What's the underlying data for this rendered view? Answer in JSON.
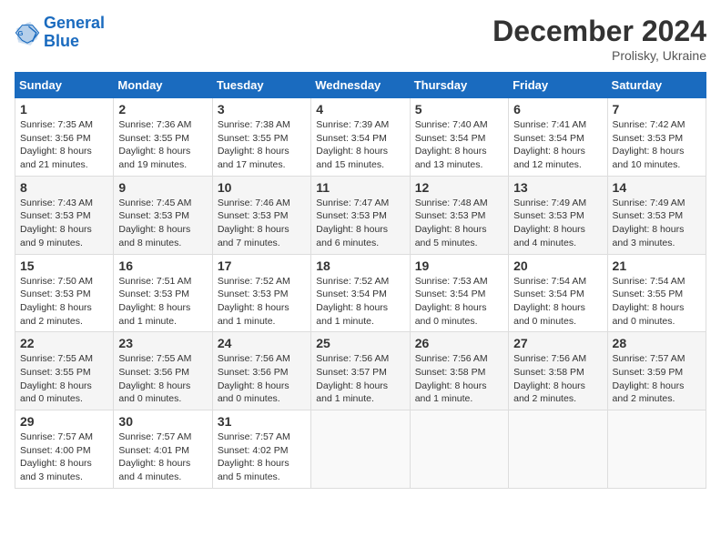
{
  "header": {
    "logo_line1": "General",
    "logo_line2": "Blue",
    "month": "December 2024",
    "location": "Prolisky, Ukraine"
  },
  "days_of_week": [
    "Sunday",
    "Monday",
    "Tuesday",
    "Wednesday",
    "Thursday",
    "Friday",
    "Saturday"
  ],
  "weeks": [
    [
      {
        "day": "1",
        "sunrise": "7:35 AM",
        "sunset": "3:56 PM",
        "daylight": "8 hours and 21 minutes."
      },
      {
        "day": "2",
        "sunrise": "7:36 AM",
        "sunset": "3:55 PM",
        "daylight": "8 hours and 19 minutes."
      },
      {
        "day": "3",
        "sunrise": "7:38 AM",
        "sunset": "3:55 PM",
        "daylight": "8 hours and 17 minutes."
      },
      {
        "day": "4",
        "sunrise": "7:39 AM",
        "sunset": "3:54 PM",
        "daylight": "8 hours and 15 minutes."
      },
      {
        "day": "5",
        "sunrise": "7:40 AM",
        "sunset": "3:54 PM",
        "daylight": "8 hours and 13 minutes."
      },
      {
        "day": "6",
        "sunrise": "7:41 AM",
        "sunset": "3:54 PM",
        "daylight": "8 hours and 12 minutes."
      },
      {
        "day": "7",
        "sunrise": "7:42 AM",
        "sunset": "3:53 PM",
        "daylight": "8 hours and 10 minutes."
      }
    ],
    [
      {
        "day": "8",
        "sunrise": "7:43 AM",
        "sunset": "3:53 PM",
        "daylight": "8 hours and 9 minutes."
      },
      {
        "day": "9",
        "sunrise": "7:45 AM",
        "sunset": "3:53 PM",
        "daylight": "8 hours and 8 minutes."
      },
      {
        "day": "10",
        "sunrise": "7:46 AM",
        "sunset": "3:53 PM",
        "daylight": "8 hours and 7 minutes."
      },
      {
        "day": "11",
        "sunrise": "7:47 AM",
        "sunset": "3:53 PM",
        "daylight": "8 hours and 6 minutes."
      },
      {
        "day": "12",
        "sunrise": "7:48 AM",
        "sunset": "3:53 PM",
        "daylight": "8 hours and 5 minutes."
      },
      {
        "day": "13",
        "sunrise": "7:49 AM",
        "sunset": "3:53 PM",
        "daylight": "8 hours and 4 minutes."
      },
      {
        "day": "14",
        "sunrise": "7:49 AM",
        "sunset": "3:53 PM",
        "daylight": "8 hours and 3 minutes."
      }
    ],
    [
      {
        "day": "15",
        "sunrise": "7:50 AM",
        "sunset": "3:53 PM",
        "daylight": "8 hours and 2 minutes."
      },
      {
        "day": "16",
        "sunrise": "7:51 AM",
        "sunset": "3:53 PM",
        "daylight": "8 hours and 1 minute."
      },
      {
        "day": "17",
        "sunrise": "7:52 AM",
        "sunset": "3:53 PM",
        "daylight": "8 hours and 1 minute."
      },
      {
        "day": "18",
        "sunrise": "7:52 AM",
        "sunset": "3:54 PM",
        "daylight": "8 hours and 1 minute."
      },
      {
        "day": "19",
        "sunrise": "7:53 AM",
        "sunset": "3:54 PM",
        "daylight": "8 hours and 0 minutes."
      },
      {
        "day": "20",
        "sunrise": "7:54 AM",
        "sunset": "3:54 PM",
        "daylight": "8 hours and 0 minutes."
      },
      {
        "day": "21",
        "sunrise": "7:54 AM",
        "sunset": "3:55 PM",
        "daylight": "8 hours and 0 minutes."
      }
    ],
    [
      {
        "day": "22",
        "sunrise": "7:55 AM",
        "sunset": "3:55 PM",
        "daylight": "8 hours and 0 minutes."
      },
      {
        "day": "23",
        "sunrise": "7:55 AM",
        "sunset": "3:56 PM",
        "daylight": "8 hours and 0 minutes."
      },
      {
        "day": "24",
        "sunrise": "7:56 AM",
        "sunset": "3:56 PM",
        "daylight": "8 hours and 0 minutes."
      },
      {
        "day": "25",
        "sunrise": "7:56 AM",
        "sunset": "3:57 PM",
        "daylight": "8 hours and 1 minute."
      },
      {
        "day": "26",
        "sunrise": "7:56 AM",
        "sunset": "3:58 PM",
        "daylight": "8 hours and 1 minute."
      },
      {
        "day": "27",
        "sunrise": "7:56 AM",
        "sunset": "3:58 PM",
        "daylight": "8 hours and 2 minutes."
      },
      {
        "day": "28",
        "sunrise": "7:57 AM",
        "sunset": "3:59 PM",
        "daylight": "8 hours and 2 minutes."
      }
    ],
    [
      {
        "day": "29",
        "sunrise": "7:57 AM",
        "sunset": "4:00 PM",
        "daylight": "8 hours and 3 minutes."
      },
      {
        "day": "30",
        "sunrise": "7:57 AM",
        "sunset": "4:01 PM",
        "daylight": "8 hours and 4 minutes."
      },
      {
        "day": "31",
        "sunrise": "7:57 AM",
        "sunset": "4:02 PM",
        "daylight": "8 hours and 5 minutes."
      },
      null,
      null,
      null,
      null
    ]
  ]
}
